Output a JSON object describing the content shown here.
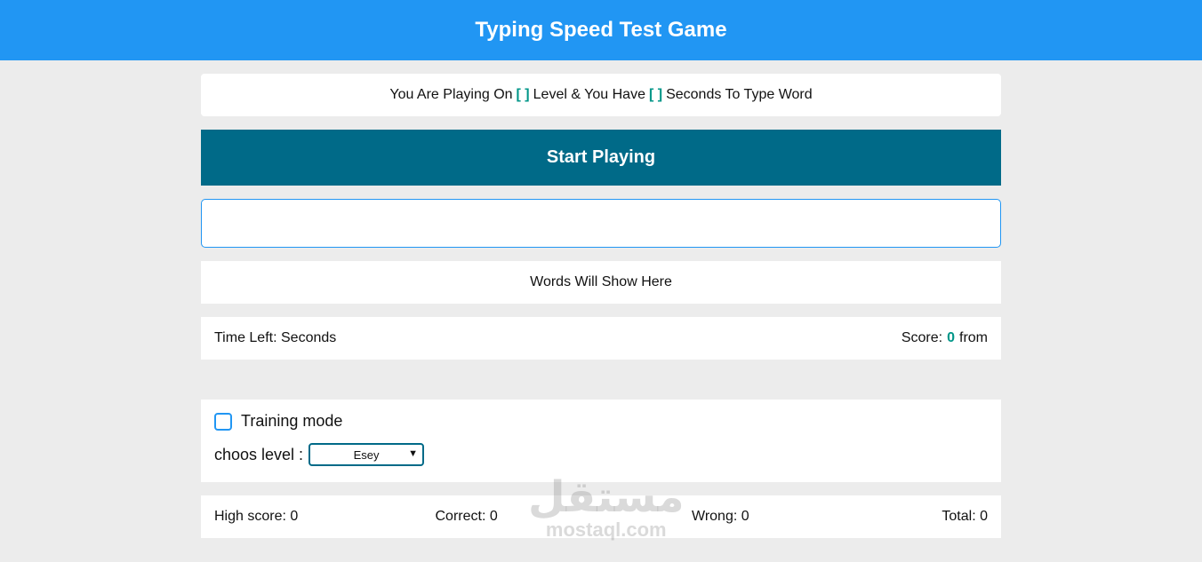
{
  "header": {
    "title": "Typing Speed Test Game"
  },
  "message": {
    "prefix": "You Are Playing On",
    "level_bracket": "[ ]",
    "middle": "Level & You Have",
    "seconds_bracket": "[ ]",
    "suffix": "Seconds To Type Word"
  },
  "start_button": {
    "label": "Start Playing"
  },
  "input": {
    "value": "",
    "placeholder": ""
  },
  "words_area": {
    "text": "Words Will Show Here"
  },
  "control": {
    "time_left_label": "Time Left:",
    "time_left_unit": "Seconds",
    "score_label": "Score:",
    "score_value": "0",
    "score_from": "from"
  },
  "settings": {
    "training_mode_label": "Training mode",
    "training_mode_checked": false,
    "level_label": "choos level :",
    "level_selected": "Esey"
  },
  "stats": {
    "high_score": "High score: 0",
    "correct": "Correct: 0",
    "wrong": "Wrong: 0",
    "total": "Total: 0"
  },
  "watermark": {
    "arabic": "مستقل",
    "latin": "mostaql.com"
  },
  "colors": {
    "header": "#2196f3",
    "start_button": "#006a88",
    "accent": "#009688",
    "background": "#ececec"
  }
}
